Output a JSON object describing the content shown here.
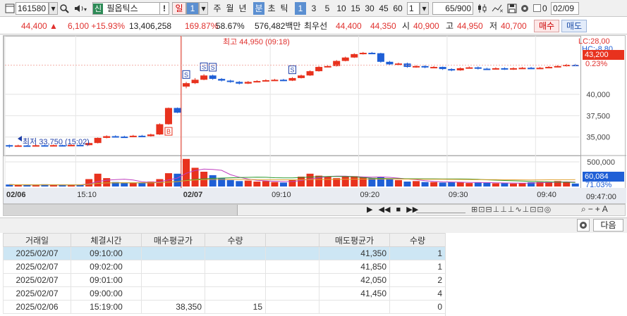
{
  "toolbar": {
    "code": "161580",
    "market_tag": "신",
    "name": "필옵틱스",
    "warn": "!",
    "period_selected": "일",
    "period_num": "1",
    "periods": [
      "주",
      "월",
      "년",
      "분",
      "초",
      "틱"
    ],
    "period_active": "분",
    "intervals": [
      "1",
      "3",
      "5",
      "10",
      "15",
      "30",
      "45",
      "60"
    ],
    "interval_active": "1",
    "unit": "1",
    "count": "65",
    "count_total": "/900",
    "date_checkbox": "0",
    "date": "02/09"
  },
  "price_row": {
    "price": "44,400 ▲",
    "change": "6,100 +15.93%",
    "volume": "13,406,258",
    "vol_ratio": "169.87%",
    "turnover": "58.67%",
    "amount": "576,482백만",
    "ask_label": "최우선",
    "ask": "44,400",
    "bid": "44,350",
    "open_label": "시",
    "open": "40,900",
    "high_label": "고",
    "high": "44,950",
    "low_label": "저",
    "low": "40,700",
    "buy_button": "매수",
    "sell_button": "매도"
  },
  "chart_labels": {
    "lc": "LC:28,00",
    "hc": "HC:-8.80",
    "current_price": "43,200",
    "current_pct": "0.23%",
    "high_marker": "최고 44,950 (09:18)",
    "low_marker": "최저 33,750 (15:02)",
    "vol_value": "60,084",
    "vol_pct": "71.03%",
    "time_last": "09:47:00"
  },
  "chart_data": [
    {
      "type": "candlestick",
      "y_ticks": [
        "40,000",
        "37,500",
        "35,000"
      ],
      "ylim": [
        33000,
        46500
      ],
      "x_labels": [
        "02/06",
        "15:10",
        "02/07",
        "09:10",
        "09:20",
        "09:30",
        "09:40"
      ],
      "annotations": [
        "최고 44,950 (09:18)",
        "최저 33,750 (15:02)"
      ],
      "candles": [
        {
          "o": 34050,
          "c": 33980,
          "h": 34120,
          "l": 33750
        },
        {
          "o": 33980,
          "c": 34020,
          "h": 34100,
          "l": 33900
        },
        {
          "o": 34020,
          "c": 33990,
          "h": 34080,
          "l": 33920
        },
        {
          "o": 33990,
          "c": 34040,
          "h": 34110,
          "l": 33950
        },
        {
          "o": 34040,
          "c": 34010,
          "h": 34090,
          "l": 33960
        },
        {
          "o": 34010,
          "c": 34050,
          "h": 34120,
          "l": 33980
        },
        {
          "o": 34050,
          "c": 34030,
          "h": 34100,
          "l": 33990
        },
        {
          "o": 34030,
          "c": 34080,
          "h": 34150,
          "l": 34000
        },
        {
          "o": 34080,
          "c": 34050,
          "h": 34120,
          "l": 34010
        },
        {
          "o": 34050,
          "c": 34300,
          "h": 34350,
          "l": 34020
        },
        {
          "o": 34300,
          "c": 34900,
          "h": 34950,
          "l": 34250
        },
        {
          "o": 34900,
          "c": 35100,
          "h": 35200,
          "l": 34850
        },
        {
          "o": 35100,
          "c": 35050,
          "h": 35200,
          "l": 34980
        },
        {
          "o": 35050,
          "c": 35000,
          "h": 35150,
          "l": 34950
        },
        {
          "o": 35000,
          "c": 35150,
          "h": 35250,
          "l": 34980
        },
        {
          "o": 35150,
          "c": 35100,
          "h": 35250,
          "l": 35050
        },
        {
          "o": 35100,
          "c": 35300,
          "h": 35400,
          "l": 35050
        },
        {
          "o": 35300,
          "c": 36500,
          "h": 36600,
          "l": 35250
        },
        {
          "o": 36500,
          "c": 38400,
          "h": 38450,
          "l": 36450
        },
        {
          "o": 38400,
          "c": 37850,
          "h": 38450,
          "l": 37800
        },
        {
          "o": 40900,
          "c": 41300,
          "h": 41450,
          "l": 40700
        },
        {
          "o": 41300,
          "c": 41700,
          "h": 41900,
          "l": 41200
        },
        {
          "o": 41700,
          "c": 42200,
          "h": 42350,
          "l": 41650
        },
        {
          "o": 42200,
          "c": 41800,
          "h": 42300,
          "l": 41700
        },
        {
          "o": 41800,
          "c": 41600,
          "h": 41900,
          "l": 41500
        },
        {
          "o": 41600,
          "c": 41450,
          "h": 41700,
          "l": 41350
        },
        {
          "o": 41450,
          "c": 41250,
          "h": 41550,
          "l": 41150
        },
        {
          "o": 41250,
          "c": 41450,
          "h": 41550,
          "l": 41200
        },
        {
          "o": 41450,
          "c": 41550,
          "h": 41650,
          "l": 41400
        },
        {
          "o": 41550,
          "c": 41650,
          "h": 41750,
          "l": 41500
        },
        {
          "o": 41650,
          "c": 41700,
          "h": 41800,
          "l": 41600
        },
        {
          "o": 41700,
          "c": 41600,
          "h": 41800,
          "l": 41550
        },
        {
          "o": 41600,
          "c": 41900,
          "h": 42000,
          "l": 41550
        },
        {
          "o": 41900,
          "c": 42200,
          "h": 42300,
          "l": 41850
        },
        {
          "o": 42200,
          "c": 42700,
          "h": 42800,
          "l": 42150
        },
        {
          "o": 42700,
          "c": 43200,
          "h": 43300,
          "l": 42650
        },
        {
          "o": 43200,
          "c": 43300,
          "h": 43450,
          "l": 43150
        },
        {
          "o": 43300,
          "c": 43900,
          "h": 44000,
          "l": 43250
        },
        {
          "o": 43900,
          "c": 44300,
          "h": 44400,
          "l": 43850
        },
        {
          "o": 44300,
          "c": 44700,
          "h": 44800,
          "l": 44250
        },
        {
          "o": 44700,
          "c": 44850,
          "h": 44950,
          "l": 44650
        },
        {
          "o": 44850,
          "c": 44800,
          "h": 44950,
          "l": 44700
        },
        {
          "o": 44800,
          "c": 43800,
          "h": 44850,
          "l": 43700
        },
        {
          "o": 43800,
          "c": 43500,
          "h": 43900,
          "l": 43400
        },
        {
          "o": 43500,
          "c": 43600,
          "h": 43700,
          "l": 43400
        },
        {
          "o": 43600,
          "c": 43200,
          "h": 43700,
          "l": 43100
        },
        {
          "o": 43200,
          "c": 43300,
          "h": 43400,
          "l": 43100
        },
        {
          "o": 43300,
          "c": 43150,
          "h": 43400,
          "l": 43050
        },
        {
          "o": 43150,
          "c": 43200,
          "h": 43300,
          "l": 43050
        },
        {
          "o": 43200,
          "c": 42950,
          "h": 43250,
          "l": 42850
        },
        {
          "o": 42950,
          "c": 42800,
          "h": 43050,
          "l": 42700
        },
        {
          "o": 42800,
          "c": 43050,
          "h": 43150,
          "l": 42750
        },
        {
          "o": 43050,
          "c": 43150,
          "h": 43250,
          "l": 43000
        },
        {
          "o": 43150,
          "c": 43000,
          "h": 43250,
          "l": 42900
        },
        {
          "o": 43000,
          "c": 42950,
          "h": 43100,
          "l": 42850
        },
        {
          "o": 42950,
          "c": 43050,
          "h": 43150,
          "l": 42900
        },
        {
          "o": 43050,
          "c": 42900,
          "h": 43150,
          "l": 42850
        },
        {
          "o": 42900,
          "c": 43050,
          "h": 43150,
          "l": 42850
        },
        {
          "o": 43050,
          "c": 43100,
          "h": 43200,
          "l": 43000
        },
        {
          "o": 43100,
          "c": 43000,
          "h": 43200,
          "l": 42950
        },
        {
          "o": 43000,
          "c": 43100,
          "h": 43200,
          "l": 42950
        },
        {
          "o": 43100,
          "c": 43200,
          "h": 43300,
          "l": 43050
        },
        {
          "o": 43200,
          "c": 43300,
          "h": 43400,
          "l": 43150
        },
        {
          "o": 43300,
          "c": 43450,
          "h": 43550,
          "l": 43250
        },
        {
          "o": 43450,
          "c": 43400,
          "h": 43550,
          "l": 43350
        }
      ]
    },
    {
      "type": "bar",
      "title": "volume",
      "y_ticks": [
        "500,000"
      ],
      "ylim": [
        0,
        600000
      ],
      "values": [
        40000,
        30000,
        35000,
        25000,
        45000,
        30000,
        28000,
        35000,
        30000,
        150000,
        260000,
        170000,
        90000,
        70000,
        75000,
        80000,
        100000,
        150000,
        270000,
        260000,
        560000,
        380000,
        300000,
        230000,
        170000,
        130000,
        110000,
        120000,
        100000,
        110000,
        90000,
        80000,
        130000,
        200000,
        260000,
        220000,
        200000,
        170000,
        200000,
        210000,
        190000,
        170000,
        200000,
        160000,
        130000,
        100000,
        110000,
        90000,
        90000,
        80000,
        85000,
        90000,
        70000,
        80000,
        75000,
        65000,
        70000,
        60000,
        70000,
        85000,
        90000,
        95000,
        110000,
        90000,
        60084
      ]
    }
  ],
  "scrollbar": {
    "buttons": [
      "◀",
      "▶",
      "▶|",
      "◀◀",
      "■",
      "▶▶"
    ]
  },
  "bottom_toolbar": {
    "next_button": "다음"
  },
  "trades": {
    "headers": [
      "거래일",
      "체결시간",
      "매수평균가",
      "수량",
      "",
      "매도평균가",
      "수량"
    ],
    "rows": [
      [
        "2025/02/07",
        "09:10:00",
        "",
        "",
        "",
        "41,350",
        "1"
      ],
      [
        "2025/02/07",
        "09:02:00",
        "",
        "",
        "",
        "41,850",
        "1"
      ],
      [
        "2025/02/07",
        "09:01:00",
        "",
        "",
        "",
        "42,050",
        "2"
      ],
      [
        "2025/02/07",
        "09:00:00",
        "",
        "",
        "",
        "41,450",
        "4"
      ],
      [
        "2025/02/06",
        "15:19:00",
        "38,350",
        "15",
        "",
        "",
        "0"
      ]
    ]
  },
  "colors": {
    "up": "#e8321e",
    "down": "#1f5fd6",
    "accent": "#5b8fd1"
  }
}
